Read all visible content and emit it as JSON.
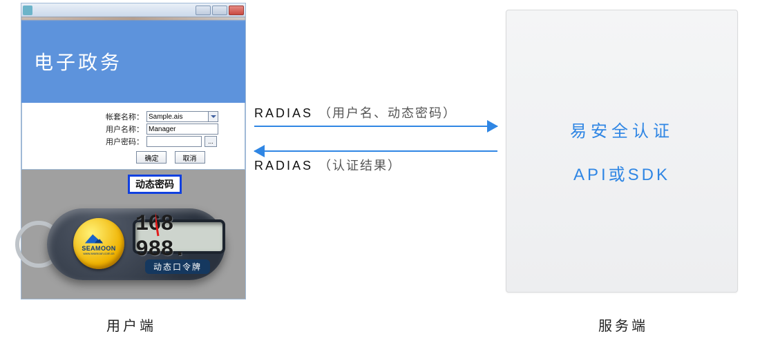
{
  "banner": {
    "title": "电子政务"
  },
  "login": {
    "suite_label": "帐套名称：",
    "suite_value": "Sample.ais",
    "username_label": "用户名称：",
    "username_value": "Manager",
    "password_label": "用户密码：",
    "password_value": "",
    "ellipsis": "...",
    "ok_label": "确定",
    "cancel_label": "取消"
  },
  "dynamic_pwd_tag": "动态密码",
  "token": {
    "brand": "SEAMOON",
    "url": "www.seamoon.com.cn",
    "lcd_value": "168 988.",
    "device_label": "动态口令牌"
  },
  "server": {
    "line1": "易安全认证",
    "line2": "API或SDK"
  },
  "flow": {
    "req_protocol": "RADIAS",
    "req_args": "（用户名、动态密码）",
    "res_protocol": "RADIAS",
    "res_args": "（认证结果）"
  },
  "captions": {
    "client": "用户端",
    "server": "服务端"
  }
}
